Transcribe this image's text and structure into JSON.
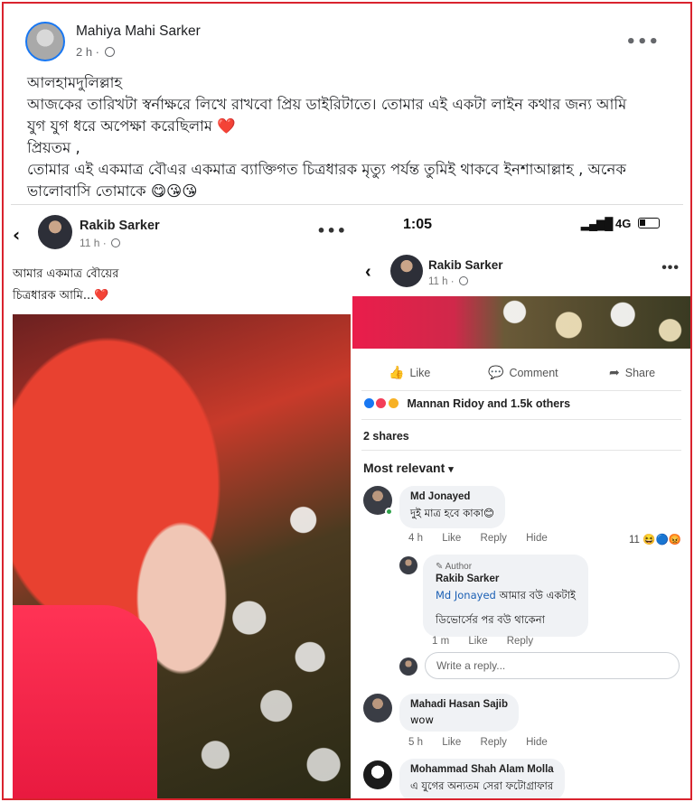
{
  "outer_post": {
    "author": "Mahiya Mahi Sarker",
    "time": "2 h ·",
    "text_lines": [
      "আলহামদুলিল্লাহ",
      "আজকের তারিখটা স্বর্নাক্ষরে লিখে রাখবো প্রিয় ডাইরিটাতে। তোমার এই একটা লাইন কথার জন্য আমি",
      "যুগ যুগ ধরে অপেক্ষা করেছিলাম ❤️",
      "প্রিয়তম ,",
      "তোমার এই একমাত্র বৌএর একমাত্র ব্যাক্তিগত চিত্রধারক মৃত্যু পর্যন্ত তুমিই থাকবে ইনশাআল্লাহ , অনেক",
      "ভালোবাসি তোমাকে 😋😘😘"
    ],
    "more_icon": "more-dots-icon"
  },
  "left_screenshot": {
    "back_icon": "chevron-left-icon",
    "author": "Rakib Sarker",
    "time": "11 h ·",
    "caption_line1": "আমার একমাত্র বৌয়ের",
    "caption_line2": "চিত্রধারক আমি...❤️"
  },
  "right_screenshot": {
    "status_time": "1:05",
    "status_network": "4G",
    "author": "Rakib Sarker",
    "time": "11 h ·",
    "actions": {
      "like": "Like",
      "comment": "Comment",
      "share": "Share"
    },
    "reactions_label": "Mannan Ridoy and 1.5k others",
    "shares": "2 shares",
    "sort_label": "Most relevant",
    "comments": [
      {
        "name": "Md Jonayed",
        "text": "দুই মাত্র হবে কাকা😊",
        "time": "4 h",
        "like": "Like",
        "reply": "Reply",
        "hide": "Hide",
        "reaction_count": "11 😆🔵😡"
      },
      {
        "author_tag": "Author",
        "name": "Rakib Sarker",
        "mention": "Md Jonayed",
        "text_line1": "আমার বউ একটাই",
        "text_line2": "ডিভোর্সের পর বউ থাকেনা",
        "time": "1 m",
        "like": "Like",
        "reply": "Reply"
      },
      {
        "name": "Mahadi Hasan Sajib",
        "text": "wow",
        "time": "5 h",
        "like": "Like",
        "reply": "Reply",
        "hide": "Hide"
      },
      {
        "name": "Mohammad Shah Alam Molla",
        "text": "এ যুগের অন্যতম সেরা ফটোগ্রাফার"
      }
    ],
    "reply_placeholder": "Write a reply..."
  },
  "colors": {
    "frame_border": "#d9232e",
    "accent_blue": "#1877f2",
    "mention_blue": "#1a5fb4"
  }
}
